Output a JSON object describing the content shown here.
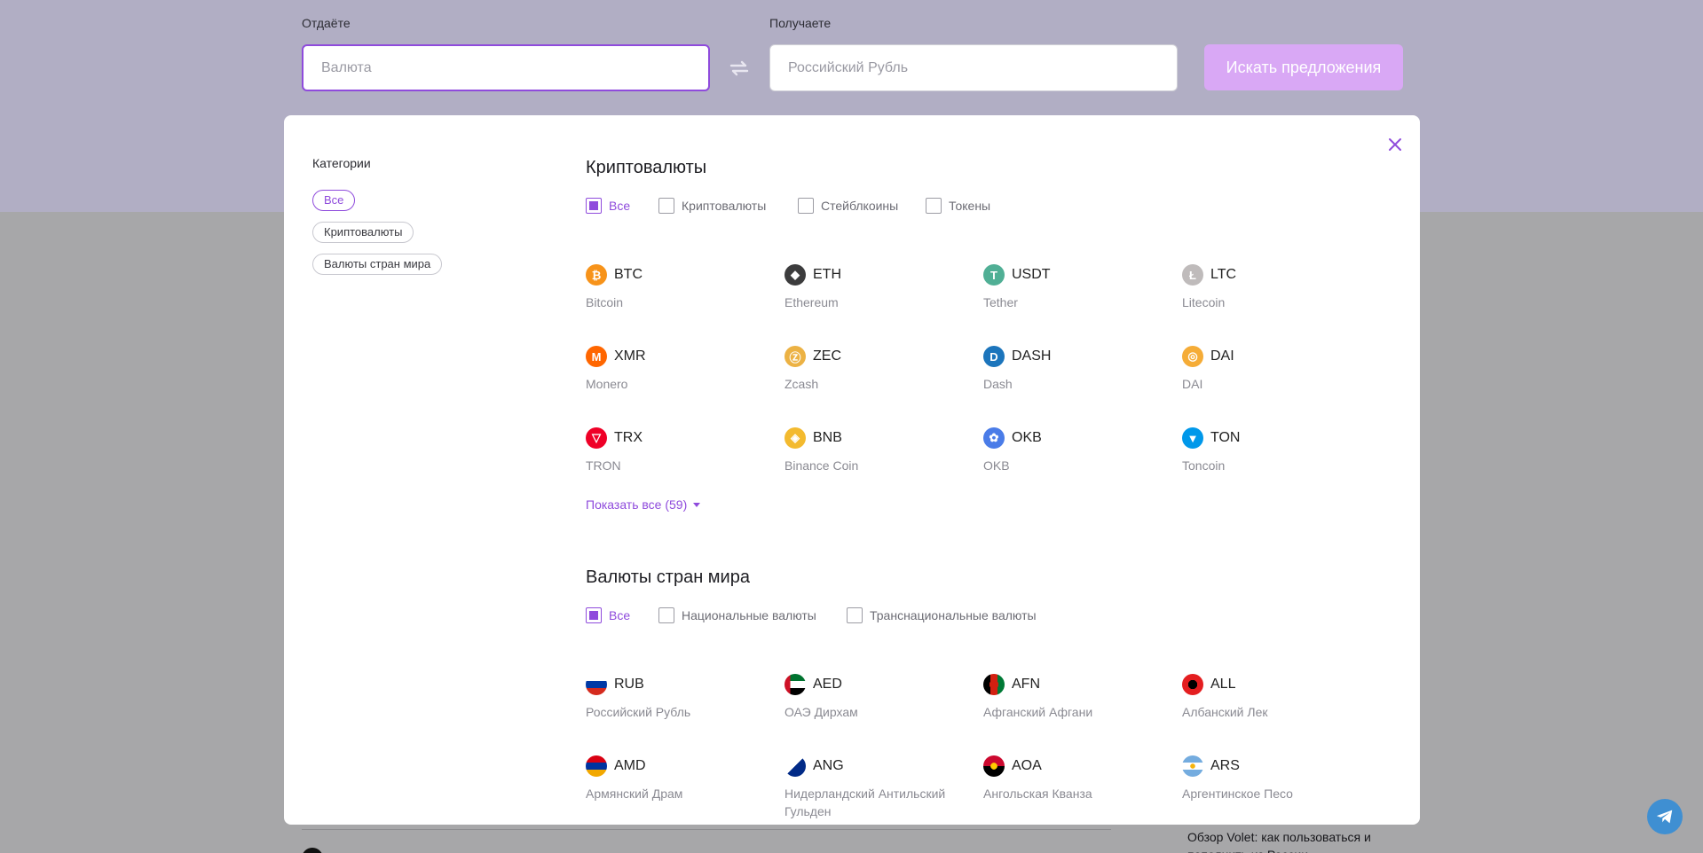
{
  "exchange": {
    "give_label": "Отдаёте",
    "give_placeholder": "Валюта",
    "get_label": "Получаете",
    "get_placeholder": "Российский Рубль",
    "search_button": "Искать предложения"
  },
  "background": {
    "article_title": "Обзор Volet: как пользоваться и пополнить из России"
  },
  "colors": {
    "accent": "#8f4bdc",
    "button": "#d9a8f5"
  },
  "categories": {
    "title": "Категории",
    "items": [
      {
        "label": "Все",
        "active": true
      },
      {
        "label": "Криптовалюты",
        "active": false
      },
      {
        "label": "Валюты стран мира",
        "active": false
      }
    ]
  },
  "crypto": {
    "title": "Криптовалюты",
    "filters": [
      {
        "label": "Все",
        "checked": true
      },
      {
        "label": "Криптовалюты",
        "checked": false
      },
      {
        "label": "Стейблкоины",
        "checked": false
      },
      {
        "label": "Токены",
        "checked": false
      }
    ],
    "items": [
      {
        "code": "BTC",
        "name": "Bitcoin",
        "icon": "bitcoin-icon",
        "color": "#f7931a",
        "glyph": "₿"
      },
      {
        "code": "ETH",
        "name": "Ethereum",
        "icon": "ethereum-icon",
        "color": "#3c3c3d",
        "glyph": "◆"
      },
      {
        "code": "USDT",
        "name": "Tether",
        "icon": "tether-icon",
        "color": "#50af95",
        "glyph": "T"
      },
      {
        "code": "LTC",
        "name": "Litecoin",
        "icon": "litecoin-icon",
        "color": "#bfbbbb",
        "glyph": "Ł"
      },
      {
        "code": "XMR",
        "name": "Monero",
        "icon": "monero-icon",
        "color": "#ff6600",
        "glyph": "M"
      },
      {
        "code": "ZEC",
        "name": "Zcash",
        "icon": "zcash-icon",
        "color": "#ecb244",
        "glyph": "Ⓩ"
      },
      {
        "code": "DASH",
        "name": "Dash",
        "icon": "dash-icon",
        "color": "#1c75bc",
        "glyph": "D"
      },
      {
        "code": "DAI",
        "name": "DAI",
        "icon": "dai-icon",
        "color": "#f5ac37",
        "glyph": "◎"
      },
      {
        "code": "TRX",
        "name": "TRON",
        "icon": "tron-icon",
        "color": "#ef0027",
        "glyph": "▽"
      },
      {
        "code": "BNB",
        "name": "Binance Coin",
        "icon": "binance-icon",
        "color": "#f3ba2f",
        "glyph": "◈"
      },
      {
        "code": "OKB",
        "name": "OKB",
        "icon": "okb-icon",
        "color": "#4a7ce8",
        "glyph": "✿"
      },
      {
        "code": "TON",
        "name": "Toncoin",
        "icon": "toncoin-icon",
        "color": "#0098ea",
        "glyph": "▼"
      }
    ],
    "show_all": "Показать все (59)"
  },
  "fiat": {
    "title": "Валюты стран мира",
    "filters": [
      {
        "label": "Все",
        "checked": true
      },
      {
        "label": "Национальные валюты",
        "checked": false
      },
      {
        "label": "Транснациональные валюты",
        "checked": false
      }
    ],
    "items": [
      {
        "code": "RUB",
        "name": "Российский Рубль",
        "icon": "russia-flag-icon",
        "flag": "linear-gradient(#ffffff 0 33%, #0039a6 33% 66%, #d52b1e 66%)"
      },
      {
        "code": "AED",
        "name": "ОАЭ Дирхам",
        "icon": "uae-flag-icon",
        "flag": "linear-gradient(90deg, #ce1126 0 28%, transparent 28%), linear-gradient(#00732f 0 33%, #ffffff 33% 66%, #000000 66%)"
      },
      {
        "code": "AFN",
        "name": "Афганский Афгани",
        "icon": "afghanistan-flag-icon",
        "flag": "radial-gradient(circle, #d32011 0 30%, transparent 31%), linear-gradient(90deg, #000000 0 33%, #d32011 33% 66%, #007a36 66%)"
      },
      {
        "code": "ALL",
        "name": "Албанский Лек",
        "icon": "albania-flag-icon",
        "flag": "radial-gradient(circle, #000000 0 30%, #e41e20 31%)"
      },
      {
        "code": "AMD",
        "name": "Армянский Драм",
        "icon": "armenia-flag-icon",
        "flag": "linear-gradient(#d90012 0 33%, #0033a0 33% 66%, #f2a800 66%)"
      },
      {
        "code": "ANG",
        "name": "Нидерландский Антильский Гульден",
        "icon": "antilles-flag-icon",
        "flag": "linear-gradient(135deg, #ffffff 0 50%, #012a87 50%)"
      },
      {
        "code": "AOA",
        "name": "Ангольская Кванза",
        "icon": "angola-flag-icon",
        "flag": "radial-gradient(circle, #ffcb00 0 22%, transparent 23%), linear-gradient(#cc092f 0 50%, #000000 50%)"
      },
      {
        "code": "ARS",
        "name": "Аргентинское Песо",
        "icon": "argentina-flag-icon",
        "flag": "radial-gradient(circle, #f6b40e 0 16%, transparent 17%), linear-gradient(#74acdf 0 33%, #ffffff 33% 66%, #74acdf 66%)"
      }
    ]
  }
}
